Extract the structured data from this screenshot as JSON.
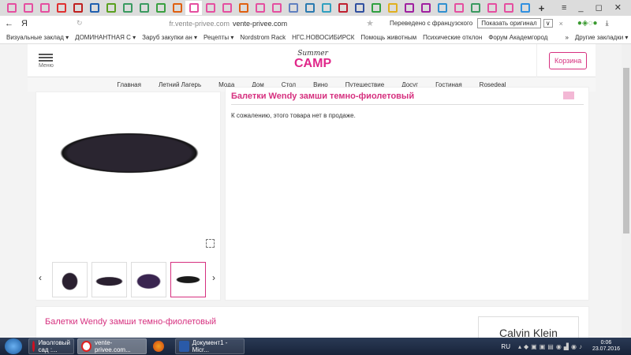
{
  "browser": {
    "tab_colors": [
      "#e54fa0",
      "#e54fa0",
      "#e54fa0",
      "#e03030",
      "#c02020",
      "#2060b0",
      "#5aa020",
      "#3a9a60",
      "#3a9a60",
      "#3aa040",
      "#e06010",
      "#e54fa0",
      "#e54fa0",
      "#e54fa0",
      "#e06010",
      "#e54fa0",
      "#e54fa0",
      "#6080c0",
      "#2a7ab0",
      "#30a0c0",
      "#c02030",
      "#3050a0",
      "#30a040",
      "#e0b020",
      "#a020a0",
      "#a020a0",
      "#3090d0",
      "#e54fa0",
      "#3a9a60",
      "#e54fa0",
      "#e54fa0",
      "#3090e0"
    ],
    "new_tab": "+",
    "window_controls": "≡ _ ◻ ✕",
    "back": "←",
    "yandex": "Я",
    "reload": "↻",
    "url_host": "fr.vente-privee.com",
    "url_title": "vente-privee.com",
    "star": "★",
    "translated": "Переведено с французского",
    "show_original": "Показать оригинал",
    "close_translate": "×",
    "bookmarks": [
      "Визуальные заклад ▾",
      "ДОМИНАНТНАЯ С ▾",
      "Заруб закупки ан ▾",
      "Рецепты ▾",
      "Nordstrom Rack",
      "НГС.НОВОСИБИРСК",
      "Помощь животным",
      "Психические отклон",
      "Форум Академгород"
    ],
    "more_bookmarks": "»",
    "other_bookmarks": "Другие закладки ▾"
  },
  "site": {
    "menu_label": "Меню",
    "logo_script": "Summer",
    "logo_main": "CAMP",
    "cart": "Корзина",
    "nav": [
      "Главная",
      "Летний Лагерь",
      "Мода",
      "Дом",
      "Стол",
      "Вино",
      "Путешествие",
      "Досуг",
      "Гостиная",
      "Rosedeal"
    ],
    "accent": "#d6307f"
  },
  "product": {
    "title": "Балетки Wendy замши темно-фиолетовый",
    "unavailable": "К сожалению, этого товара нет в продаже.",
    "thumb_prev": "‹",
    "thumb_next": "›",
    "bottom_title": "Балетки Wendy замши темно-фиолетовый",
    "brand": "Calvin Klein"
  },
  "taskbar": {
    "items": [
      "Иволговый сад :...",
      "vente-privee.com...",
      "",
      "Документ1 - Micr..."
    ],
    "lang": "RU",
    "time": "0:06",
    "date": "23.07.2016"
  }
}
